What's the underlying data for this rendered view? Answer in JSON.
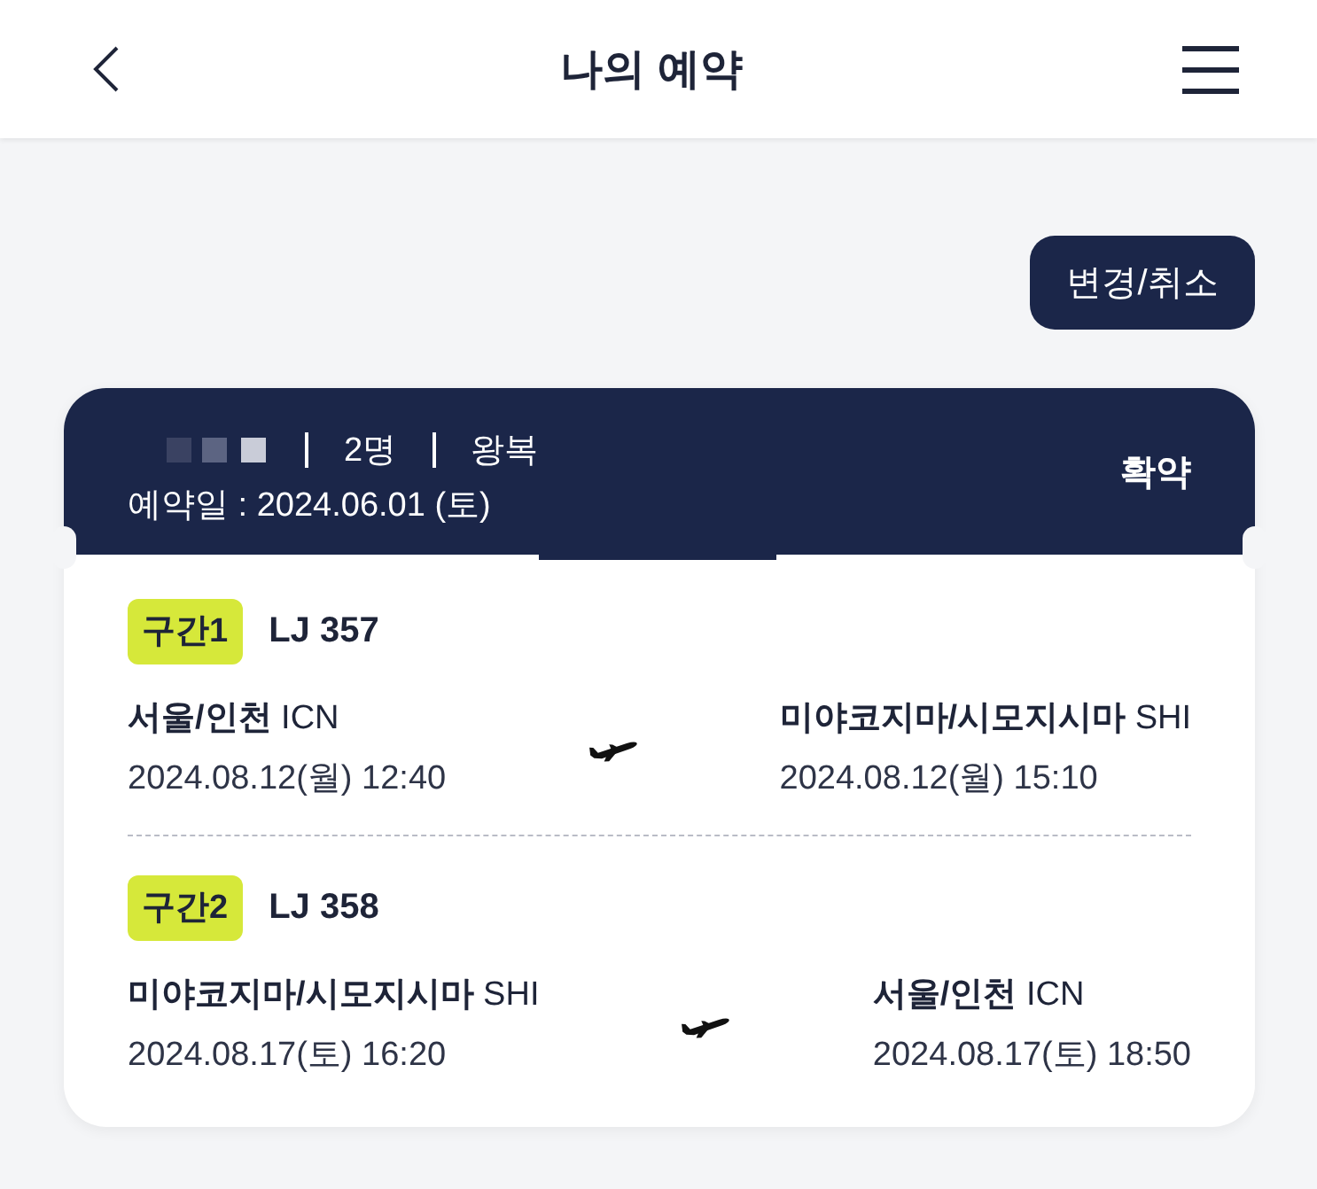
{
  "top_bar": {
    "title": "나의 예약"
  },
  "change_cancel_button": {
    "label": "변경/취소"
  },
  "booking": {
    "passengers": "2명",
    "trip_type": "왕복",
    "booked_on": "예약일 : 2024.06.01 (토)",
    "status": "확약",
    "segments": [
      {
        "badge": "구간1",
        "flight": "LJ 357",
        "departure": {
          "airport": "**서울/인천** ICN",
          "time": "2024.08.12(월) 12:40"
        },
        "arrival": {
          "airport": "**미야코지마/시모지시마** SHI",
          "time": "2024.08.12(월) 15:10"
        }
      },
      {
        "badge": "구간2",
        "flight": "LJ 358",
        "departure": {
          "airport": "**미야코지마/시모지시마** SHI",
          "time": "2024.08.17(토) 16:20"
        },
        "arrival": {
          "airport": "**서울/인천** ICN",
          "time": "2024.08.17(토) 18:50"
        }
      }
    ]
  }
}
